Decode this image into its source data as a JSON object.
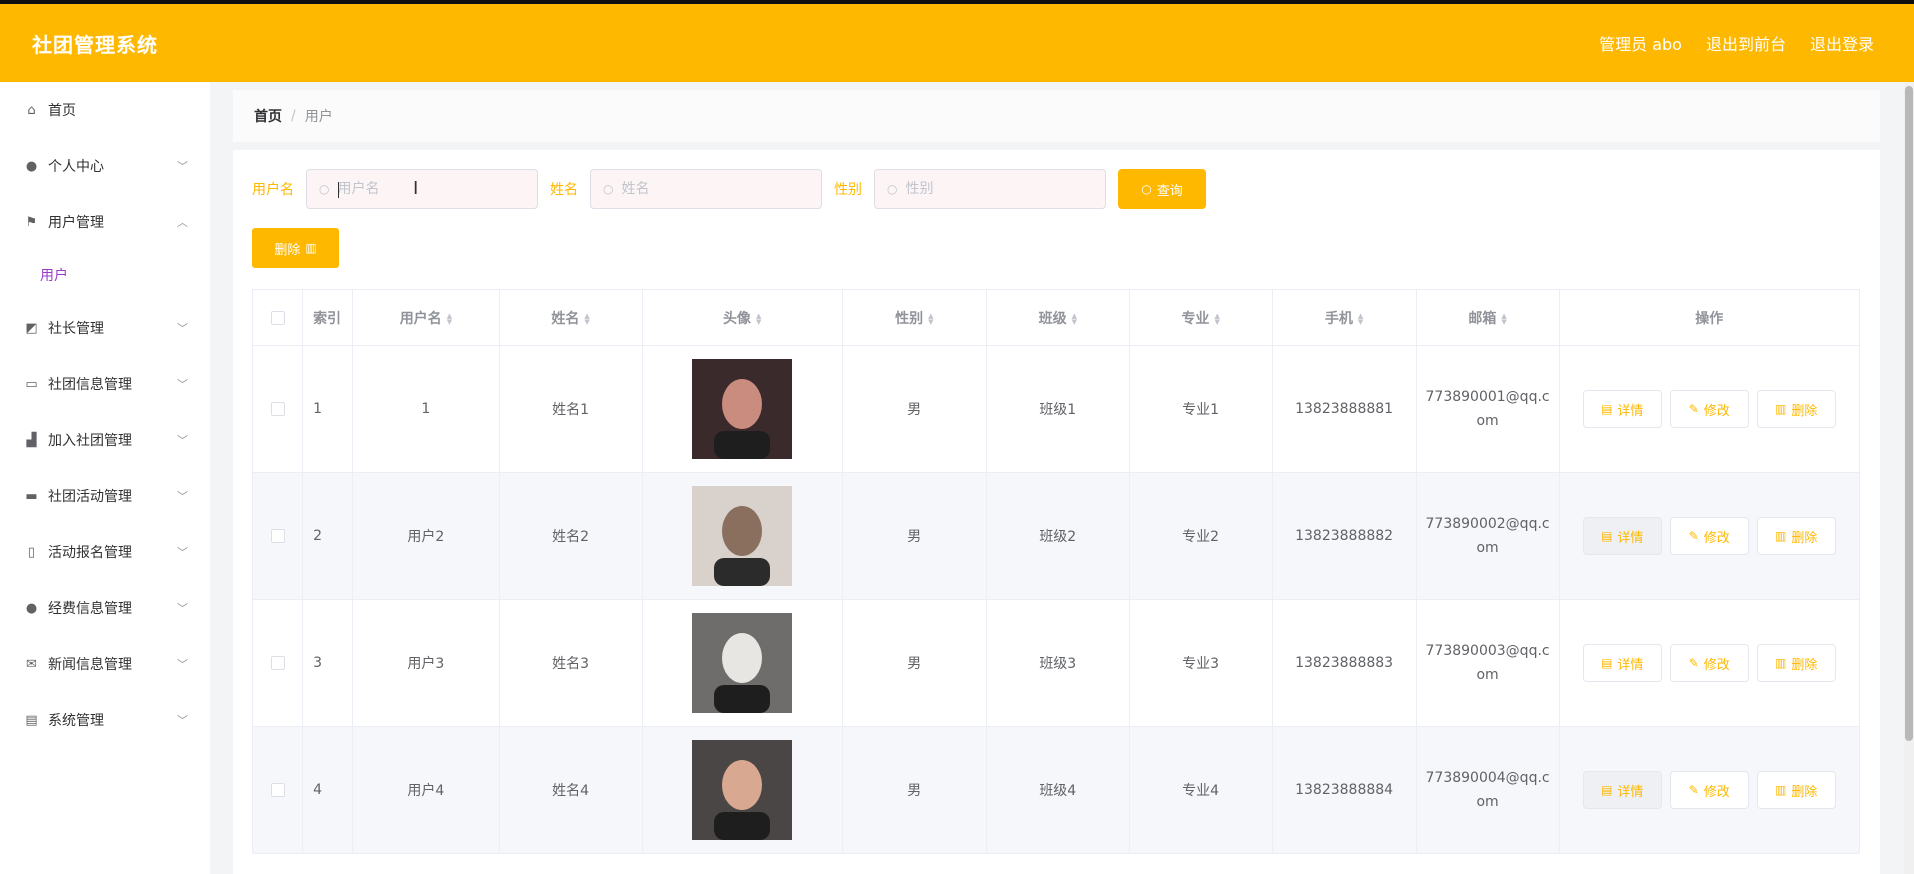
{
  "header": {
    "title": "社团管理系统",
    "admin": "管理员 abo",
    "to_front": "退出到前台",
    "logout": "退出登录"
  },
  "sidebar": {
    "items": [
      {
        "label": "首页",
        "icon": "home-icon",
        "expandable": false
      },
      {
        "label": "个人中心",
        "icon": "user-icon",
        "expandable": true
      },
      {
        "label": "用户管理",
        "icon": "flag-icon",
        "expandable": true,
        "expanded": true,
        "children": [
          "用户"
        ]
      },
      {
        "label": "社长管理",
        "icon": "chart-icon",
        "expandable": true
      },
      {
        "label": "社团信息管理",
        "icon": "chat-icon",
        "expandable": true
      },
      {
        "label": "加入社团管理",
        "icon": "thumb-icon",
        "expandable": true
      },
      {
        "label": "社团活动管理",
        "icon": "monitor-icon",
        "expandable": true
      },
      {
        "label": "活动报名管理",
        "icon": "mobile-icon",
        "expandable": true
      },
      {
        "label": "经费信息管理",
        "icon": "person-icon",
        "expandable": true
      },
      {
        "label": "新闻信息管理",
        "icon": "mail-icon",
        "expandable": true
      },
      {
        "label": "系统管理",
        "icon": "clipboard-icon",
        "expandable": true
      }
    ]
  },
  "breadcrumb": {
    "home": "首页",
    "current": "用户"
  },
  "search": {
    "username_label": "用户名",
    "username_placeholder": "用户名",
    "name_label": "姓名",
    "name_placeholder": "姓名",
    "gender_label": "性别",
    "gender_placeholder": "性别",
    "query_button": "查询"
  },
  "toolbar": {
    "delete_button": "删除"
  },
  "table": {
    "columns": [
      "索引",
      "用户名",
      "姓名",
      "头像",
      "性别",
      "班级",
      "专业",
      "手机",
      "邮箱",
      "操作"
    ],
    "actions": {
      "detail": "详情",
      "edit": "修改",
      "delete": "删除"
    },
    "rows": [
      {
        "index": "1",
        "username": "1",
        "name": "姓名1",
        "gender": "男",
        "class": "班级1",
        "major": "专业1",
        "phone": "13823888881",
        "email": "773890001@qq.com",
        "avatar_colors": [
          "#3b2a2c",
          "#c98c7e"
        ]
      },
      {
        "index": "2",
        "username": "用户2",
        "name": "姓名2",
        "gender": "男",
        "class": "班级2",
        "major": "专业2",
        "phone": "13823888882",
        "email": "773890002@qq.com",
        "avatar_colors": [
          "#d9d2cc",
          "#8a6e5e"
        ]
      },
      {
        "index": "3",
        "username": "用户3",
        "name": "姓名3",
        "gender": "男",
        "class": "班级3",
        "major": "专业3",
        "phone": "13823888883",
        "email": "773890003@qq.com",
        "avatar_colors": [
          "#6f6d6b",
          "#e8e6e2"
        ]
      },
      {
        "index": "4",
        "username": "用户4",
        "name": "姓名4",
        "gender": "男",
        "class": "班级4",
        "major": "专业4",
        "phone": "13823888884",
        "email": "773890004@qq.com",
        "avatar_colors": [
          "#4a4646",
          "#d9a891"
        ]
      }
    ]
  },
  "colors": {
    "accent": "#ffb800",
    "submenu_active": "#9b3cc9"
  }
}
